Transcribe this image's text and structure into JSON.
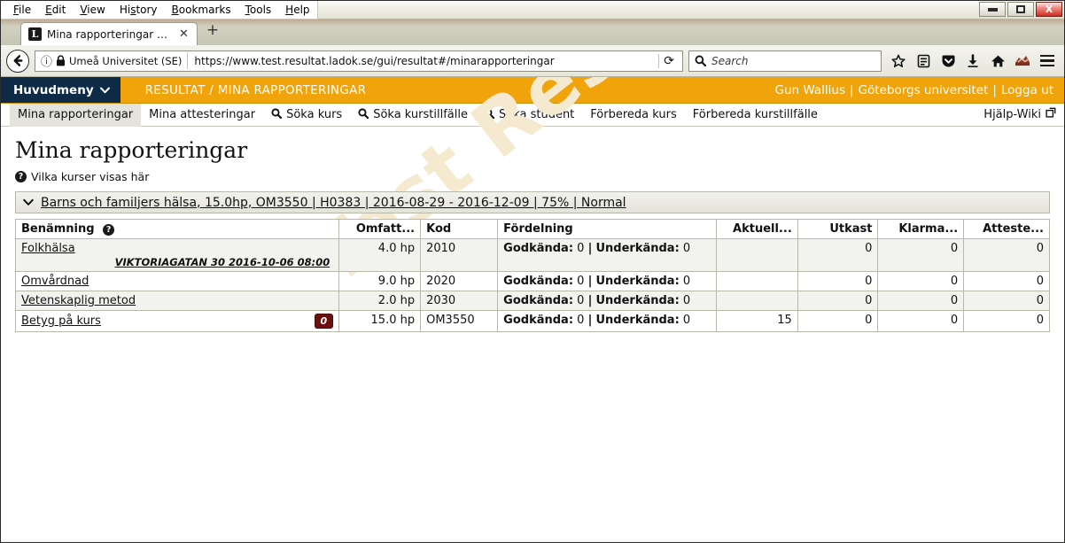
{
  "browser": {
    "menu_items": [
      "File",
      "Edit",
      "View",
      "History",
      "Bookmarks",
      "Tools",
      "Help"
    ],
    "window_buttons": {
      "minimize": "minimize-icon",
      "maximize": "restore-icon",
      "close": "X"
    },
    "tab": {
      "favicon_letter": "L",
      "title": "Mina rapporteringar - Parti...",
      "close_label": "✕"
    },
    "new_tab_label": "+",
    "back_icon": "←",
    "identity": {
      "info_icon": "ⓘ",
      "lock_icon": "lock",
      "label": "Umeå Universitet (SE)"
    },
    "url": "https://www.test.resultat.ladok.se/gui/resultat#/minarapporteringar",
    "reload_icon": "⟳",
    "search": {
      "placeholder": "Search",
      "icon": "search-icon"
    },
    "toolbar_icons": [
      "star-icon",
      "library-icon",
      "pocket-icon",
      "download-icon",
      "home-icon",
      "extension-icon",
      "menu-icon"
    ]
  },
  "app": {
    "main_menu_label": "Huvudmeny",
    "main_menu_caret": "⌵",
    "breadcrumb": "RESULTAT / MINA RAPPORTERINGAR",
    "user_name": "Gun Wallius",
    "organisation": "Göteborgs universitet",
    "logout_label": "Logga ut",
    "separator": "|",
    "accent_color": "#f0a30a",
    "menu_color": "#0d2a47"
  },
  "subnav": {
    "items": [
      {
        "label": "Mina rapporteringar",
        "icon": "",
        "active": true
      },
      {
        "label": "Mina attesteringar",
        "icon": "",
        "active": false
      },
      {
        "label": "Söka kurs",
        "icon": "search-icon",
        "active": false
      },
      {
        "label": "Söka kurstillfälle",
        "icon": "search-icon",
        "active": false
      },
      {
        "label": "Söka student",
        "icon": "search-icon",
        "active": false
      },
      {
        "label": "Förbereda kurs",
        "icon": "",
        "active": false
      },
      {
        "label": "Förbereda kurstillfälle",
        "icon": "",
        "active": false
      }
    ],
    "help_label": "Hjälp-Wiki",
    "help_icon": "external-link-icon"
  },
  "page": {
    "title": "Mina rapporteringar",
    "info_link": "Vilka kurser visas här",
    "info_icon": "question-icon",
    "watermark": "Test Resultat"
  },
  "course": {
    "expand_icon": "chevron-down-icon",
    "header": "Barns och familjers hälsa, 15.0hp, OM3550 | H0383 | 2016-08-29 - 2016-12-09 | 75% | Normal"
  },
  "table": {
    "columns": [
      {
        "label": "Benämning",
        "icon": "question-icon",
        "align": "left"
      },
      {
        "label": "Omfatt...",
        "align": "right"
      },
      {
        "label": "Kod",
        "align": "left"
      },
      {
        "label": "Fördelning",
        "align": "left"
      },
      {
        "label": "Aktuell...",
        "align": "right"
      },
      {
        "label": "Utkast",
        "align": "right"
      },
      {
        "label": "Klarma...",
        "align": "right"
      },
      {
        "label": "Atteste...",
        "align": "right"
      }
    ],
    "rows": [
      {
        "name": "Folkhälsa",
        "sub": "VIKTORIAGATAN 30 2016-10-06 08:00",
        "badge": "",
        "omfattning": "4.0 hp",
        "kod": "2010",
        "godkanda_label": "Godkända:",
        "godkanda": "0",
        "underkanda_label": "Underkända:",
        "underkanda": "0",
        "aktuell": "",
        "utkast": "0",
        "klarmarkerade": "0",
        "attesterade": "0"
      },
      {
        "name": "Omvårdnad",
        "sub": "",
        "badge": "",
        "omfattning": "9.0 hp",
        "kod": "2020",
        "godkanda_label": "Godkända:",
        "godkanda": "0",
        "underkanda_label": "Underkända:",
        "underkanda": "0",
        "aktuell": "",
        "utkast": "0",
        "klarmarkerade": "0",
        "attesterade": "0"
      },
      {
        "name": "Vetenskaplig metod",
        "sub": "",
        "badge": "",
        "omfattning": "2.0 hp",
        "kod": "2030",
        "godkanda_label": "Godkända:",
        "godkanda": "0",
        "underkanda_label": "Underkända:",
        "underkanda": "0",
        "aktuell": "",
        "utkast": "0",
        "klarmarkerade": "0",
        "attesterade": "0"
      },
      {
        "name": "Betyg på kurs",
        "sub": "",
        "badge": "0",
        "omfattning": "15.0 hp",
        "kod": "OM3550",
        "godkanda_label": "Godkända:",
        "godkanda": "0",
        "underkanda_label": "Underkända:",
        "underkanda": "0",
        "aktuell": "15",
        "utkast": "0",
        "klarmarkerade": "0",
        "attesterade": "0"
      }
    ]
  }
}
